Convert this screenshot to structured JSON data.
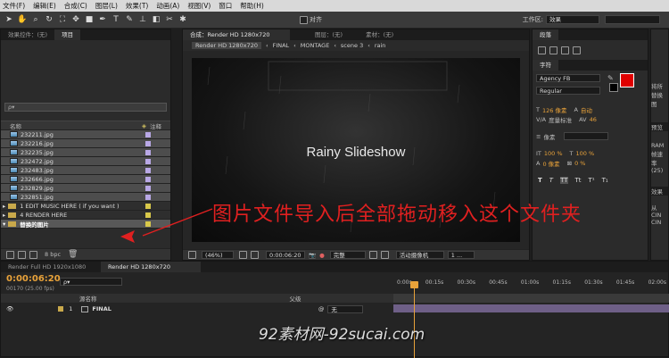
{
  "menu": [
    "文件(F)",
    "编辑(E)",
    "合成(C)",
    "图层(L)",
    "效果(T)",
    "动画(A)",
    "视图(V)",
    "窗口",
    "帮助(H)"
  ],
  "toolbar": {
    "align_label": "对齐",
    "workspace_label": "工作区:",
    "workspace_value": "效果"
  },
  "left_panel": {
    "tabs": [
      "效果控件：(无)",
      "项目"
    ],
    "search_placeholder": "ρ▾",
    "col_name": "名称",
    "col_note": "注释",
    "files": [
      "232211.jpg",
      "232216.jpg",
      "232235.jpg",
      "232472.jpg",
      "232483.jpg",
      "232666.jpg",
      "232829.jpg",
      "232851.jpg"
    ],
    "folders": [
      "1 EDIT MUSIC HERE ( if you want )",
      "4 RENDER HERE",
      "替换的图片"
    ],
    "bpc": "8 bpc"
  },
  "comp_panel": {
    "tabs": [
      "合成：Render HD 1280x720",
      "图层：(无)",
      "素材：(无)"
    ],
    "breadcrumbs": [
      "Render HD 1280x720",
      "FINAL",
      "MONTAGE",
      "scene 3",
      "rain"
    ],
    "viewer_text": "Rainy Slideshow",
    "zoom": "(46%)",
    "timecode": "0:00:06:20",
    "resolution": "完整",
    "camera": "活动摄像机",
    "views": "1 ..."
  },
  "right_panel": {
    "tabs": [
      "段落",
      "字符"
    ],
    "font_family": "Agency FB",
    "font_style": "Regular",
    "font_size": "126 像素",
    "leading": "自动",
    "kerning": "度量标准",
    "tracking": "46",
    "stroke_unit": "像素",
    "vscale": "100 %",
    "hscale": "100 %",
    "baseline": "0 像素",
    "tsume": "0 %",
    "fill_color": "#e00000",
    "style_buttons": [
      "T",
      "T",
      "TT",
      "Tt",
      "T¹",
      "T₁"
    ],
    "edge_tabs": [
      "预览",
      "效果"
    ],
    "edge_texts": [
      "将所",
      "替换图",
      "RAM",
      "帧速率",
      "(25)",
      "从",
      "CIN",
      "CIN"
    ]
  },
  "timeline": {
    "tabs": [
      "Render Full HD 1920x1080",
      "Render HD 1280x720"
    ],
    "timecode": "0:00:06:20",
    "fps_label": "00170 (25.00 fps)",
    "search_placeholder": "ρ▾",
    "col_source": "源名称",
    "col_parent": "父级",
    "layer_index": "1",
    "layer_name": "FINAL",
    "parent_value": "无",
    "ruler": [
      "0:00s",
      "00:15s",
      "00:30s",
      "00:45s",
      "01:00s",
      "01:15s",
      "01:30s",
      "01:45s",
      "02:00s"
    ]
  },
  "annotation": {
    "text": "图片文件导入后全部拖动移入这个文件夹",
    "color": "#e02020"
  },
  "watermark": "92素材网-92sucai.com"
}
